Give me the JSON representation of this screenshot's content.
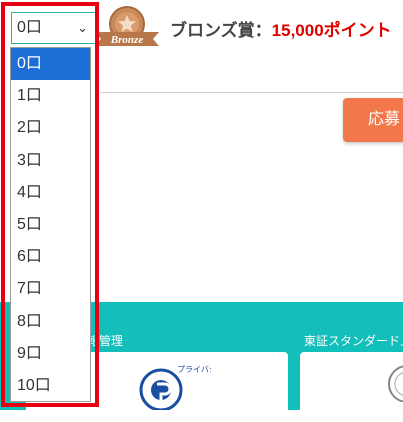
{
  "quantity_select": {
    "value": "0口",
    "options": [
      "0口",
      "1口",
      "2口",
      "3口",
      "4口",
      "5口",
      "6口",
      "7口",
      "8口",
      "9口",
      "10口"
    ],
    "selected_index": 0
  },
  "medal": {
    "text": "Bronze",
    "icon": "star-medal-icon"
  },
  "prize": {
    "label": "ブロンズ賞：",
    "points": "15,000ポイント"
  },
  "apply_button": {
    "label": "応募"
  },
  "cards": [
    {
      "label": "報管理",
      "icon": "privacy-mark-icon",
      "icon_text": "プライバシー"
    },
    {
      "label": "東証スタンダード上",
      "icon": "stamp-icon"
    }
  ],
  "colors": {
    "teal": "#13bfba",
    "accent_orange": "#f2784b",
    "highlight_red": "#e60012",
    "selection_blue": "#1e6ed8",
    "points_red": "#e00000"
  }
}
